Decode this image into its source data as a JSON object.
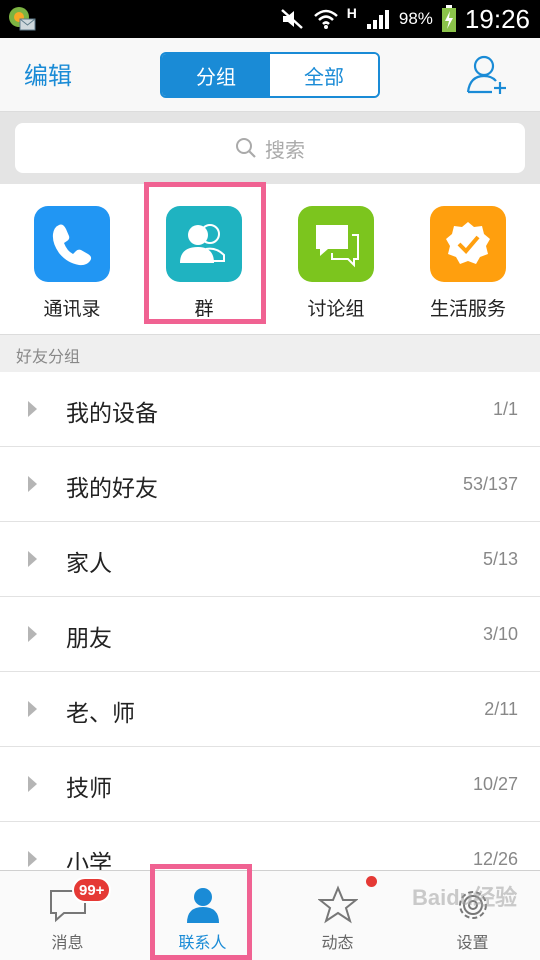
{
  "status_bar": {
    "network": "H",
    "battery": "98%",
    "time": "19:26"
  },
  "header": {
    "edit": "编辑",
    "segments": [
      "分组",
      "全部"
    ],
    "add_contact_icon": "add-user-icon"
  },
  "search": {
    "placeholder": "搜索",
    "icon": "search-icon"
  },
  "apps": [
    {
      "label": "通讯录",
      "icon": "phone-icon",
      "color": "#2196f3"
    },
    {
      "label": "群",
      "icon": "group-icon",
      "color": "#1fb3c1"
    },
    {
      "label": "讨论组",
      "icon": "chat-bubbles-icon",
      "color": "#7cc51e"
    },
    {
      "label": "生活服务",
      "icon": "badge-check-icon",
      "color": "#ff9f0e"
    }
  ],
  "section_title": "好友分组",
  "groups": [
    {
      "name": "我的设备",
      "count": "1/1"
    },
    {
      "name": "我的好友",
      "count": "53/137"
    },
    {
      "name": "家人",
      "count": "5/13"
    },
    {
      "name": "朋友",
      "count": "3/10"
    },
    {
      "name": "老、师",
      "count": "2/11"
    },
    {
      "name": "技师",
      "count": "10/27"
    },
    {
      "name": "小学",
      "count": "12/26"
    }
  ],
  "tabs": [
    {
      "label": "消息",
      "icon": "message-icon",
      "badge": "99+"
    },
    {
      "label": "联系人",
      "icon": "contact-icon"
    },
    {
      "label": "动态",
      "icon": "star-icon"
    },
    {
      "label": "设置",
      "icon": "gear-icon"
    }
  ],
  "colors": {
    "accent": "#1a8bd6",
    "highlight": "#f06292",
    "badge": "#e53935"
  },
  "watermark": "Baidu经验"
}
